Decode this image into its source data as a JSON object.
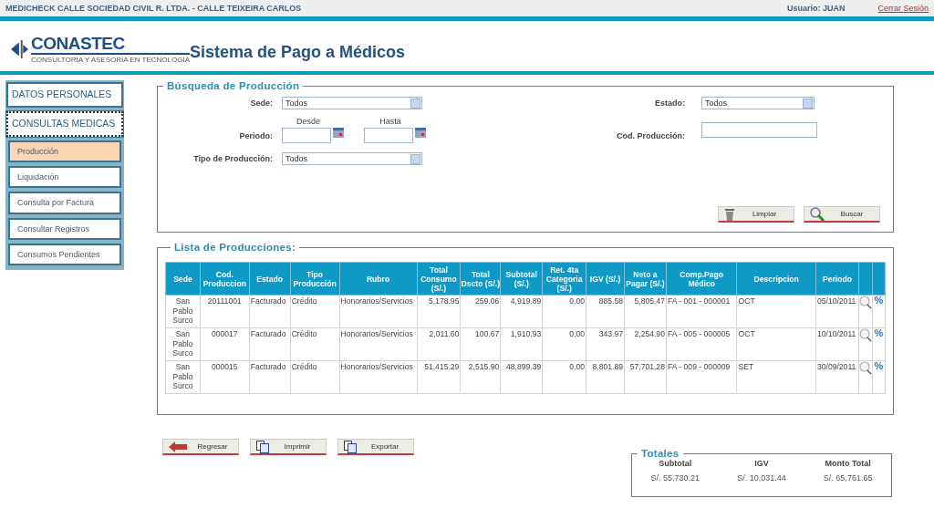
{
  "top_bar": {
    "company": "MEDICHECK CALLE SOCIEDAD CIVIL R. LTDA. - CALLE TEIXEIRA CARLOS",
    "user": "Usuario: JUAN",
    "logout": "Cerrar Sesión"
  },
  "header": {
    "logo_name": "CONASTEC",
    "logo_tagline": "CONSULTORIA Y ASESORIA EN TECNOLOGIA",
    "title": "Sistema de Pago a Médicos"
  },
  "sidebar": {
    "items": [
      {
        "kind": "section",
        "label": "DATOS PERSONALES",
        "selected": false
      },
      {
        "kind": "section",
        "label": "CONSULTAS MEDICAS",
        "selected": true
      },
      {
        "kind": "link",
        "label": "Producción",
        "selected": true
      },
      {
        "kind": "link",
        "label": "Liquidación",
        "selected": false
      },
      {
        "kind": "link",
        "label": "Consulta por Factura",
        "selected": false
      },
      {
        "kind": "link",
        "label": "Consultar Registros",
        "selected": false
      },
      {
        "kind": "link",
        "label": "Consumos Pendientes",
        "selected": false
      }
    ]
  },
  "search": {
    "title": "Búsqueda de Producción",
    "sede": {
      "label": "Sede:",
      "value": "Todos"
    },
    "estado": {
      "label": "Estado:",
      "value": "Todos"
    },
    "periodo": {
      "label": "Periodo:",
      "from_label": "Desde",
      "to_label": "Hasta"
    },
    "cod_produccion": {
      "label": "Cod. Producción:"
    },
    "tipo": {
      "label": "Tipo de Producción:",
      "value": "Todos"
    },
    "buttons": [
      {
        "kind": "trash",
        "label": "Limpiar"
      },
      {
        "kind": "search",
        "label": "Buscar"
      }
    ]
  },
  "list": {
    "title": "Lista de Producciones:",
    "columns": [
      "Sede",
      "Cod. Produccion",
      "Estado",
      "Tipo Producción",
      "Rubro",
      "Total Consumo (S/.)",
      "Total Dscto (S/.)",
      "Subtotal (S/.)",
      "Ret. 4ta Categoria (S/.)",
      "IGV (S/.)",
      "Neto a Pagar (S/.)",
      "Comp.Pago Médico",
      "Descripcion",
      "Periodo"
    ],
    "rows": [
      {
        "cells": [
          "San Pablo Surco",
          "20111001",
          "Facturado",
          "Crédito",
          "Honorarios/Servicios",
          "5,178.95",
          "259.06",
          "4,919.89",
          "0.00",
          "885.58",
          "5,805.47",
          "FA - 001 - 000001",
          "OCT",
          "05/10/2011"
        ],
        "action": "%"
      },
      {
        "cells": [
          "San Pablo Surco",
          "000017",
          "Facturado",
          "Crédito",
          "Honorarios/Servicios",
          "2,011.60",
          "100.67",
          "1,910.93",
          "0.00",
          "343.97",
          "2,254.90",
          "FA - 005 - 000005",
          "OCT",
          "10/10/2011"
        ],
        "action": "%"
      },
      {
        "cells": [
          "San Pablo Surco",
          "000015",
          "Facturado",
          "Crédito",
          "Honorarios/Servicios",
          "51,415.29",
          "2,515.90",
          "48,899.39",
          "0.00",
          "8,801.89",
          "57,701.28",
          "FA - 009 - 000009",
          "SET",
          "30/09/2011"
        ],
        "action": "%"
      }
    ]
  },
  "actions": [
    {
      "kind": "back",
      "label": "Regresar"
    },
    {
      "kind": "copy",
      "label": "Imprimir"
    },
    {
      "kind": "copy",
      "label": "Exportar"
    }
  ],
  "totals": {
    "title": "Totales",
    "items": [
      {
        "label": "Subtotal",
        "value": "S/. 55,730.21"
      },
      {
        "label": "IGV",
        "value": "S/. 10,031.44"
      },
      {
        "label": "Monto Total",
        "value": "S/. 65,761.65"
      }
    ]
  }
}
